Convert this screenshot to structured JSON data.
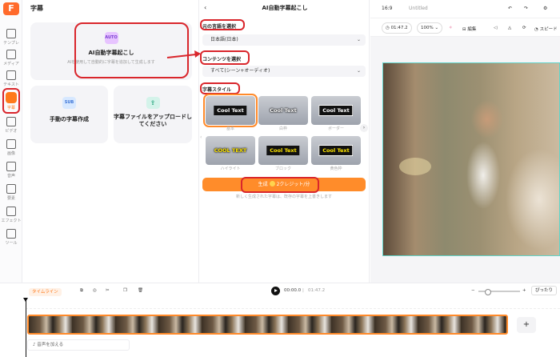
{
  "rail": {
    "logo": "F",
    "items": [
      {
        "label": "テンプレ",
        "icon": "template-icon"
      },
      {
        "label": "メディア",
        "icon": "media-icon"
      },
      {
        "label": "テキスト",
        "icon": "text-icon"
      },
      {
        "label": "字幕",
        "icon": "subtitle-icon"
      },
      {
        "label": "ビデオ",
        "icon": "video-icon"
      },
      {
        "label": "画像",
        "icon": "image-icon"
      },
      {
        "label": "音声",
        "icon": "audio-icon"
      },
      {
        "label": "要素",
        "icon": "element-icon"
      },
      {
        "label": "エフェクト",
        "icon": "effect-icon"
      },
      {
        "label": "ツール",
        "icon": "tool-icon"
      }
    ],
    "active_index": 3
  },
  "subtitle_panel": {
    "title": "字幕",
    "ai_card": {
      "badge": "AUTO",
      "title": "AI自動字幕起こし",
      "desc": "AIを使用して自動的に字幕を追加して生成します"
    },
    "manual_card": {
      "badge": "SUB",
      "title": "手動の字幕作成"
    },
    "upload_card": {
      "badge": "⇪",
      "title": "字幕ファイルをアップロードしてください"
    }
  },
  "ai_panel": {
    "back": "‹",
    "title": "AI自動字幕起こし",
    "language_label": "元の言語を選択",
    "language_value": "日本語(日本)",
    "content_label": "コンテンツを選択",
    "content_value": "すべて(シーン+オーディオ)",
    "style_label": "字幕スタイル",
    "styles": [
      {
        "sample": "Cool Text",
        "name": "基本",
        "bg": "#111111",
        "fg": "#ffffff"
      },
      {
        "sample": "Cool Text",
        "name": "白枠",
        "bg": "transparent",
        "fg": "#ffffff"
      },
      {
        "sample": "Cool Text",
        "name": "ボーダー",
        "bg": "#111111",
        "fg": "#ffffff"
      },
      {
        "sample": "COOL TEXT",
        "name": "ハイライト",
        "bg": "transparent",
        "fg": "#ffe600"
      },
      {
        "sample": "Cool Text",
        "name": "ブロック",
        "bg": "#111111",
        "fg": "#ffe600"
      },
      {
        "sample": "Cool Text",
        "name": "黄色枠",
        "bg": "#111111",
        "fg": "#ffe600"
      }
    ],
    "selected_style_index": 0,
    "generate_label": "生成",
    "generate_credits": "2クレジット/分",
    "note": "新しく生成された字幕は、既存の字幕を上書きします"
  },
  "preview": {
    "aspect": "16:9",
    "project_name": "Untitled",
    "duration": "01:47.2",
    "zoom": "100%",
    "edit_label": "編集",
    "speed_label": "スピード"
  },
  "timeline": {
    "tab_label": "タイムライン",
    "current_time": "00:00.0",
    "total_time": "01:47.2",
    "fit_label": "ぴったり",
    "add_audio_label": "音声を加える",
    "add_track_symbol": "+"
  },
  "colors": {
    "accent": "#ff8c2a",
    "highlight": "#d9262c",
    "video_border": "#61d5c9"
  }
}
